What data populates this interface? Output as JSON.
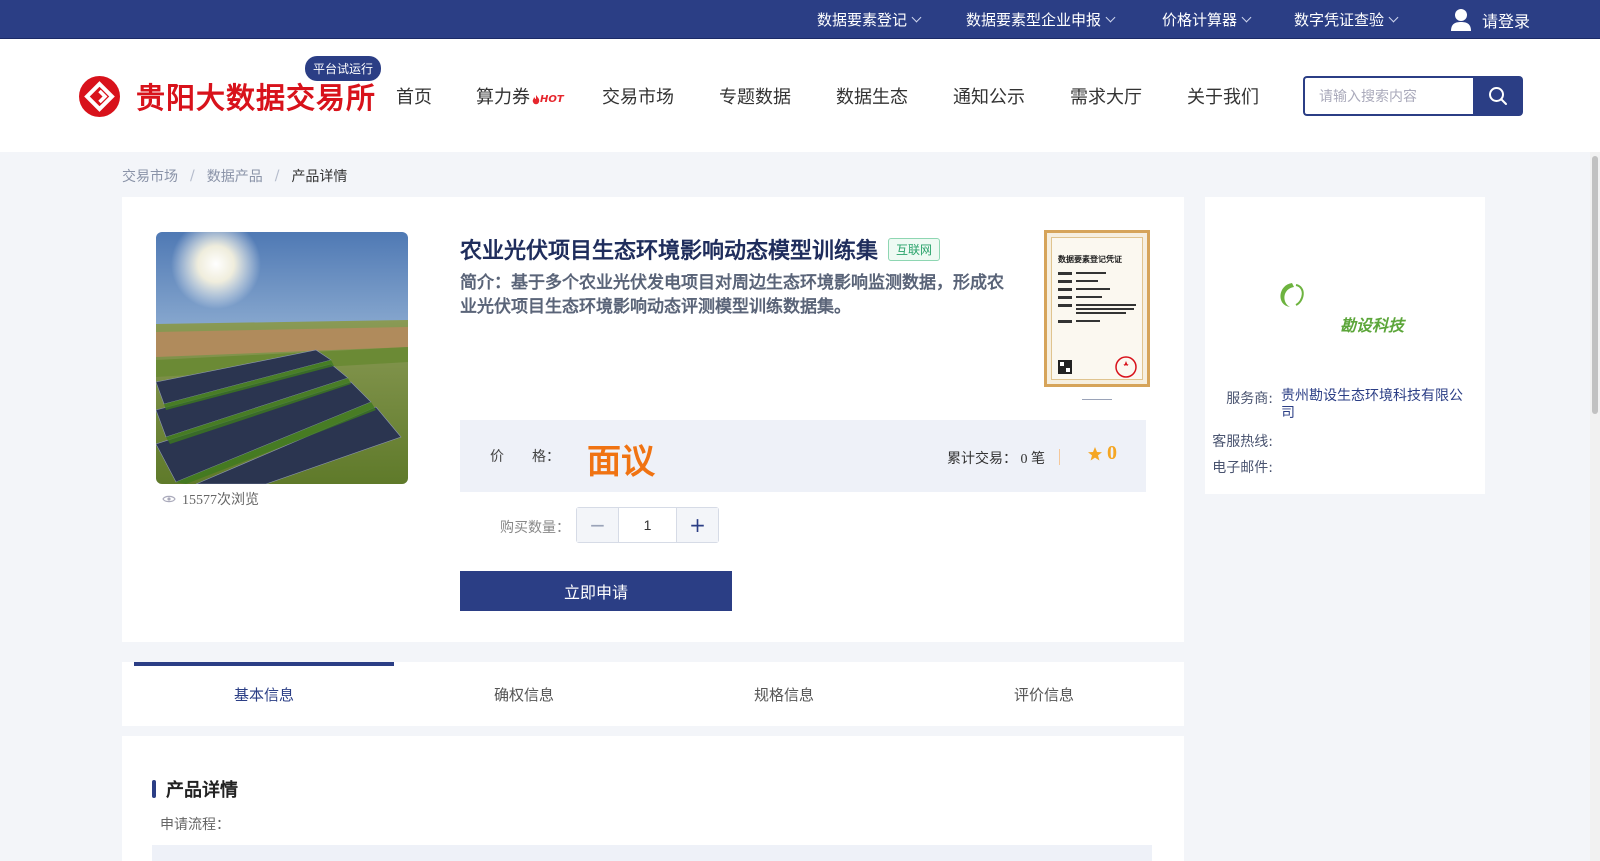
{
  "topbar": {
    "items": [
      {
        "label": "数据要素登记"
      },
      {
        "label": "数据要素型企业申报"
      },
      {
        "label": "价格计算器"
      },
      {
        "label": "数字凭证查验"
      }
    ],
    "login_label": "请登录"
  },
  "header": {
    "logo_text": "贵阳大数据交易所",
    "trial_badge": "平台试运行",
    "nav": [
      {
        "label": "首页"
      },
      {
        "label": "算力券",
        "badge": "HOT"
      },
      {
        "label": "交易市场"
      },
      {
        "label": "专题数据"
      },
      {
        "label": "数据生态"
      },
      {
        "label": "通知公示"
      },
      {
        "label": "需求大厅"
      },
      {
        "label": "关于我们"
      }
    ],
    "search_placeholder": "请输入搜索内容"
  },
  "breadcrumb": {
    "items": [
      "交易市场",
      "数据产品",
      "产品详情"
    ]
  },
  "product": {
    "title": "农业光伏项目生态环境影响动态模型训练集",
    "tag": "互联网",
    "description": "简介：基于多个农业光伏发电项目对周边生态环境影响监测数据，形成农业光伏项目生态环境影响动态评测模型训练数据集。",
    "views": "15577次浏览",
    "cert_title": "数据要素登记凭证",
    "price_label": "价　　格：",
    "price_value": "面议",
    "trade_label": "累计交易：",
    "trade_count": "0 笔",
    "rating": "0",
    "qty_label": "购买数量：",
    "qty_value": "1",
    "apply_label": "立即申请"
  },
  "vendor": {
    "logo_text": "勘设科技",
    "provider_label": "服务商:",
    "provider_value": "贵州勘设生态环境科技有限公司",
    "hotline_label": "客服热线:",
    "hotline_value": "",
    "email_label": "电子邮件:",
    "email_value": ""
  },
  "tabs": [
    {
      "label": "基本信息",
      "active": true
    },
    {
      "label": "确权信息"
    },
    {
      "label": "规格信息"
    },
    {
      "label": "评价信息"
    }
  ],
  "details": {
    "title": "产品详情",
    "process_label": "申请流程："
  },
  "colors": {
    "brand": "#2b3e85",
    "logo_red": "#d8121b",
    "price_orange": "#f07312",
    "star": "#f5a623"
  }
}
